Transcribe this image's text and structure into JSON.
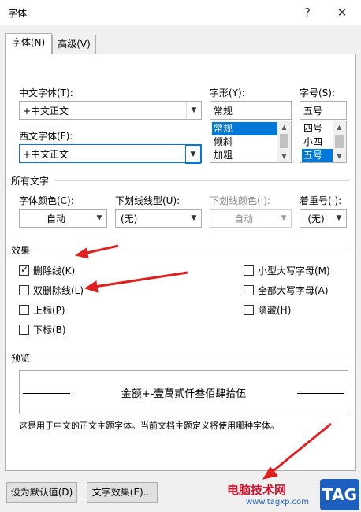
{
  "window": {
    "title": "字体",
    "help_glyph": "?",
    "close_glyph": "✕"
  },
  "tabs": [
    {
      "label": "字体(N)"
    },
    {
      "label": "高级(V)"
    }
  ],
  "font_section": {
    "cn_font_label": "中文字体(T):",
    "cn_font_value": "+中文正文",
    "west_font_label": "西文字体(F):",
    "west_font_value": "+中文正文",
    "style_label": "字形(Y):",
    "style_value": "常规",
    "style_options": [
      "常规",
      "倾斜",
      "加粗"
    ],
    "size_label": "字号(S):",
    "size_value": "五号",
    "size_options": [
      "四号",
      "小四",
      "五号"
    ]
  },
  "all_text": {
    "heading": "所有文字",
    "color_label": "字体颜色(C):",
    "color_value": "自动",
    "underline_style_label": "下划线线型(U):",
    "underline_style_value": "(无)",
    "underline_color_label": "下划线颜色(I):",
    "underline_color_value": "自动",
    "emphasis_label": "着重号(·):",
    "emphasis_value": "(无)"
  },
  "effects": {
    "heading": "效果",
    "left": [
      {
        "label": "删除线(K)",
        "checked": true
      },
      {
        "label": "双删除线(L)",
        "checked": false
      },
      {
        "label": "上标(P)",
        "checked": false
      },
      {
        "label": "下标(B)",
        "checked": false
      }
    ],
    "right": [
      {
        "label": "小型大写字母(M)",
        "checked": false
      },
      {
        "label": "全部大写字母(A)",
        "checked": false
      },
      {
        "label": "隐藏(H)",
        "checked": false
      }
    ]
  },
  "preview": {
    "heading": "预览",
    "sample_text": "金额+-壹萬貳仟叁佰肆拾伍",
    "description": "这是用于中文的正文主题字体。当前文档主题定义将使用哪种字体。"
  },
  "buttons": {
    "set_default": "设为默认值(D)",
    "text_effects": "文字效果(E)..."
  },
  "watermark": {
    "brand_text": "电脑技术网",
    "site_text": "www.tagxp.com",
    "badge_text": "TAG"
  },
  "colors": {
    "accent": "#0078d7",
    "arrow": "#e02020",
    "watermark_red": "#d0122c",
    "badge_bg": "#1d5fbf"
  }
}
